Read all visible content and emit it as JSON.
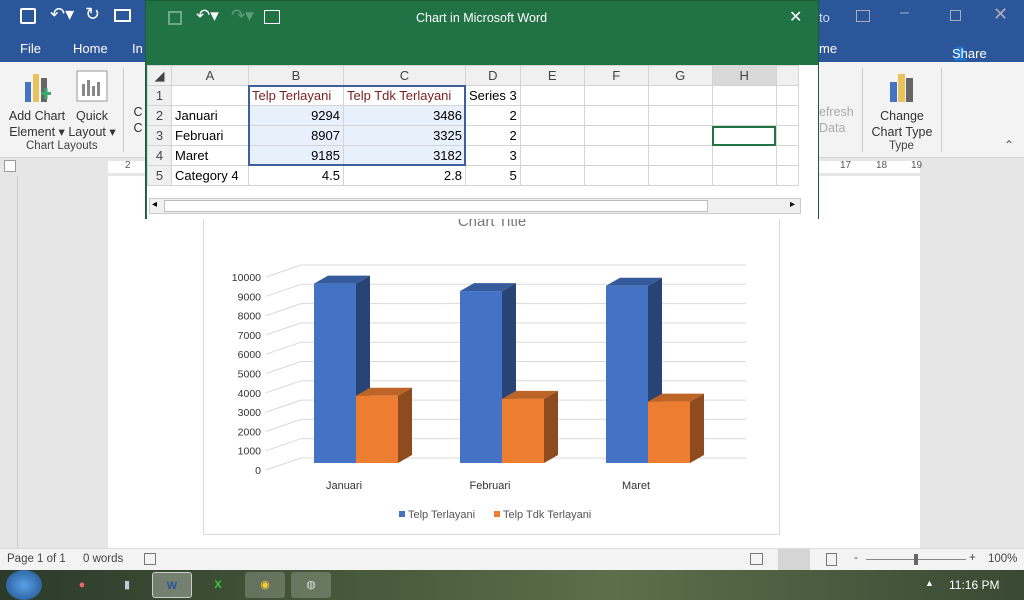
{
  "word": {
    "tabs": [
      "File",
      "Home",
      "In",
      "me"
    ],
    "share": "Share",
    "title_fragment": "to",
    "ribbon": {
      "add_chart": [
        "Add Chart",
        "Element ▾"
      ],
      "quick_layout": [
        "Quick",
        "Layout ▾"
      ],
      "group_chart_layouts": "Chart Layouts",
      "refresh": [
        "efresh",
        "Data"
      ],
      "change_type": [
        "Change",
        "Chart Type"
      ],
      "group_type": "Type",
      "partial": [
        "C",
        "C"
      ]
    },
    "ruler": {
      "left": "2",
      "right": [
        "17",
        "18",
        "19"
      ]
    },
    "status": {
      "page": "Page 1 of 1",
      "words": "0 words",
      "zoom": "100%",
      "zoom_level": 100
    }
  },
  "excel": {
    "title": "Chart in Microsoft Word",
    "columns": [
      "A",
      "B",
      "C",
      "D",
      "E",
      "F",
      "G",
      "H"
    ],
    "rows": [
      [
        "",
        "Telp Terlayani",
        "Telp Tdk Terlayani",
        "Series 3"
      ],
      [
        "Januari",
        "9294",
        "3486",
        "2"
      ],
      [
        "Februari",
        "8907",
        "3325",
        "2"
      ],
      [
        "Maret",
        "9185",
        "3182",
        "3"
      ],
      [
        "Category 4",
        "4.5",
        "2.8",
        "5"
      ]
    ]
  },
  "taskbar": {
    "time": "11:16 PM",
    "apps": [
      "firefox-icon",
      "notepad-icon",
      "word-icon",
      "excel-icon",
      "chrome-icon",
      "paint-icon"
    ]
  },
  "chart_data": {
    "type": "bar",
    "title": "Chart Title",
    "categories": [
      "Januari",
      "Februari",
      "Maret"
    ],
    "series": [
      {
        "name": "Telp Terlayani",
        "values": [
          9294,
          8907,
          9185
        ],
        "color": "#4472c4"
      },
      {
        "name": "Telp Tdk Terlayani",
        "values": [
          3486,
          3325,
          3182
        ],
        "color": "#ed7d31"
      }
    ],
    "ylim": [
      0,
      10000
    ],
    "yticks": [
      0,
      1000,
      2000,
      3000,
      4000,
      5000,
      6000,
      7000,
      8000,
      9000,
      10000
    ],
    "grid": true,
    "legend": "bottom",
    "style": "3d-column"
  }
}
